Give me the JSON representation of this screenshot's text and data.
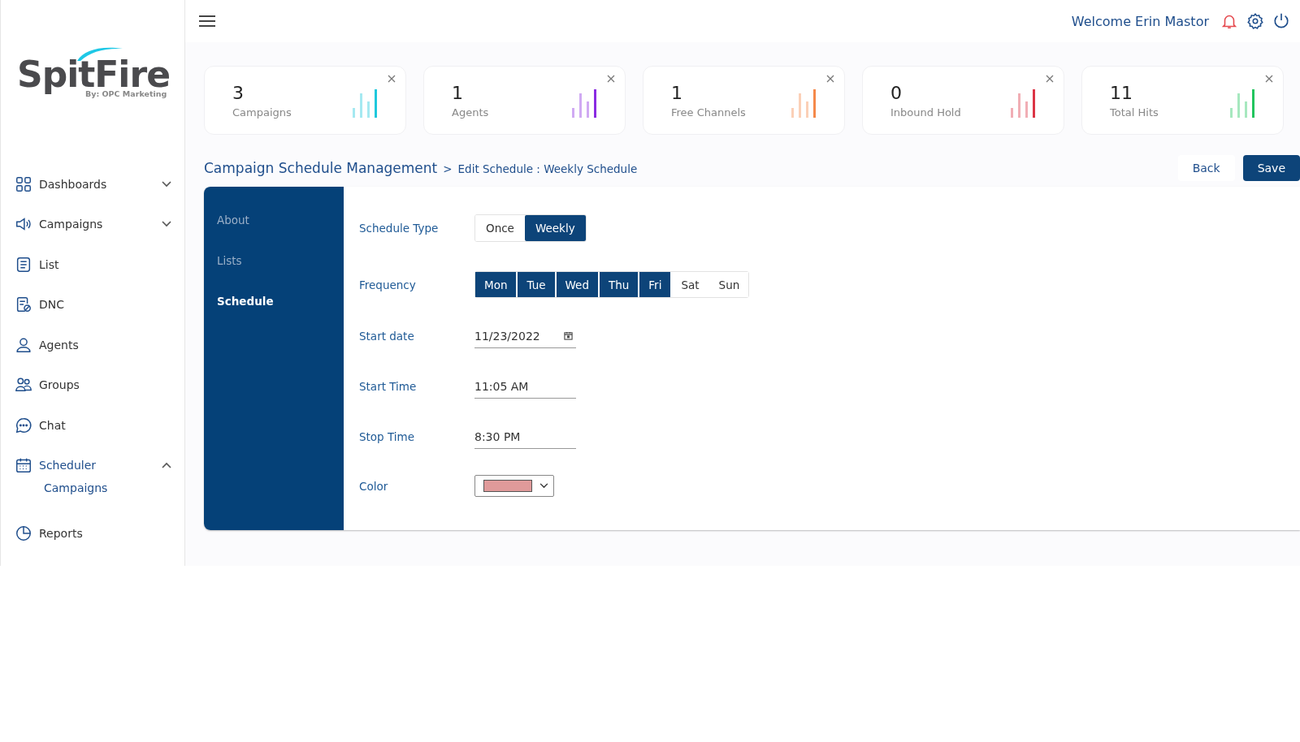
{
  "logo": {
    "name": "SpitFire",
    "tagline": "By: OPC Marketing"
  },
  "sidebar": {
    "items": [
      {
        "label": "Dashboards",
        "selected": false,
        "expanded": false
      },
      {
        "label": "Campaigns",
        "selected": false,
        "expanded": false
      },
      {
        "label": "List",
        "selected": false
      },
      {
        "label": "DNC",
        "selected": false
      },
      {
        "label": "Agents",
        "selected": false
      },
      {
        "label": "Groups",
        "selected": false
      },
      {
        "label": "Chat",
        "selected": false
      },
      {
        "label": "Scheduler",
        "selected": true,
        "expanded": true,
        "children": [
          {
            "label": "Campaigns",
            "selected": true
          }
        ]
      },
      {
        "label": "Reports",
        "selected": false
      }
    ]
  },
  "header": {
    "welcome": "Welcome Erin Mastor"
  },
  "stats": [
    {
      "value": "3",
      "label": "Campaigns",
      "color": "#1ec8dc"
    },
    {
      "value": "1",
      "label": "Agents",
      "color": "#8a2be2"
    },
    {
      "value": "1",
      "label": "Free Channels",
      "color": "#f5894a"
    },
    {
      "value": "0",
      "label": "Inbound Hold",
      "color": "#dc3545"
    },
    {
      "value": "11",
      "label": "Total Hits",
      "color": "#22c55e"
    }
  ],
  "breadcrumb": {
    "title": "Campaign Schedule Management",
    "separator": ">",
    "current": "Edit Schedule : Weekly Schedule"
  },
  "actions": {
    "back": "Back",
    "save": "Save"
  },
  "tabs": [
    {
      "label": "About",
      "selected": false
    },
    {
      "label": "Lists",
      "selected": false
    },
    {
      "label": "Schedule",
      "selected": true
    }
  ],
  "form": {
    "schedule_type": {
      "label": "Schedule Type",
      "options": [
        {
          "label": "Once",
          "selected": false
        },
        {
          "label": "Weekly",
          "selected": true
        }
      ]
    },
    "frequency": {
      "label": "Frequency",
      "days": [
        {
          "label": "Mon",
          "selected": true
        },
        {
          "label": "Tue",
          "selected": true
        },
        {
          "label": "Wed",
          "selected": true
        },
        {
          "label": "Thu",
          "selected": true
        },
        {
          "label": "Fri",
          "selected": true
        },
        {
          "label": "Sat",
          "selected": false
        },
        {
          "label": "Sun",
          "selected": false
        }
      ]
    },
    "start_date": {
      "label": "Start date",
      "value": "11/23/2022"
    },
    "start_time": {
      "label": "Start Time",
      "value": "11:05 AM"
    },
    "stop_time": {
      "label": "Stop Time",
      "value": "8:30 PM"
    },
    "color": {
      "label": "Color",
      "color": "#e09a9a"
    }
  }
}
